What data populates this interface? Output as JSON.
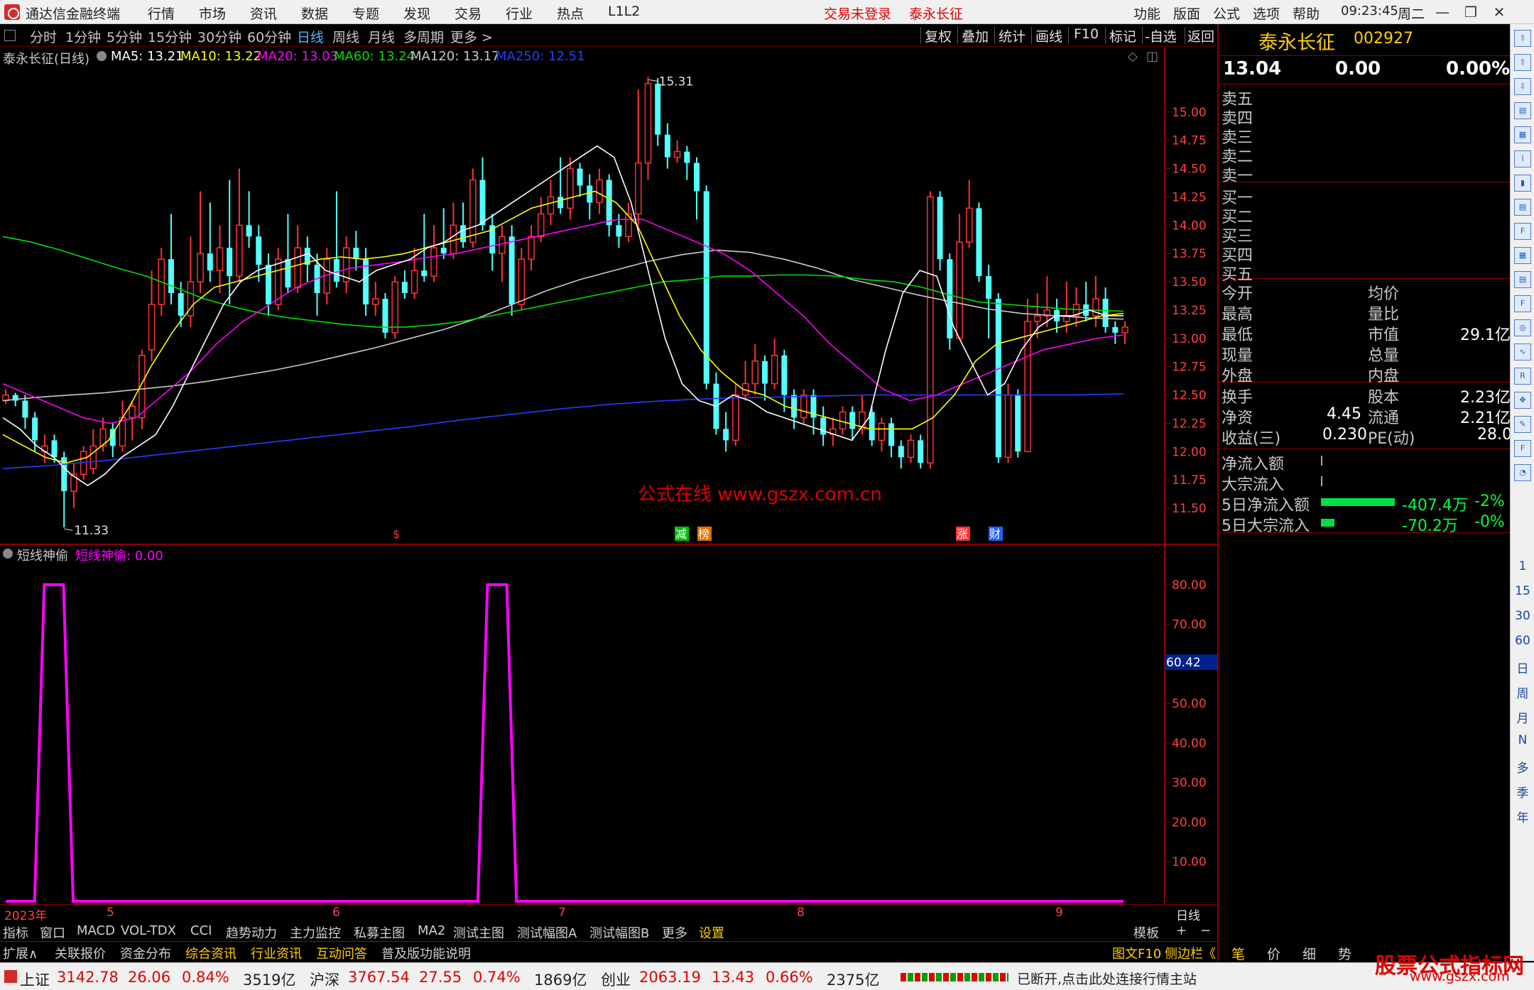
{
  "titlebar": {
    "app_name": "通达信金融终端",
    "menus": [
      "行情",
      "市场",
      "资讯",
      "数据",
      "专题",
      "发现",
      "交易",
      "行业",
      "热点",
      "L1L2"
    ],
    "login_status": "交易未登录",
    "stock_name": "泰永长征",
    "right_menus": [
      "功能",
      "版面",
      "公式",
      "选项",
      "帮助"
    ],
    "time": "09:23:45",
    "weekday": "周二"
  },
  "periodbar": {
    "periods": [
      "分时",
      "1分钟",
      "5分钟",
      "15分钟",
      "30分钟",
      "60分钟",
      "日线",
      "周线",
      "月线",
      "多周期",
      "更多 >"
    ],
    "active": "日线",
    "tools": [
      "复权",
      "叠加",
      "统计",
      "画线",
      "F10",
      "标记",
      "-自选",
      "返回"
    ]
  },
  "main_legend": {
    "title": "泰永长征(日线)",
    "items": [
      {
        "label": "MA5: 13.21",
        "color": "#ffffff"
      },
      {
        "label": "MA10: 13.22",
        "color": "#ffff00"
      },
      {
        "label": "MA20: 13.03",
        "color": "#ff00ff"
      },
      {
        "label": "MA60: 13.24",
        "color": "#00e000"
      },
      {
        "label": "MA120: 13.17",
        "color": "#c8c8c8"
      },
      {
        "label": "MA250: 12.51",
        "color": "#2040ff"
      }
    ]
  },
  "price_axis": [
    "15.00",
    "14.75",
    "14.50",
    "14.25",
    "14.00",
    "13.75",
    "13.50",
    "13.25",
    "13.00",
    "12.75",
    "12.50",
    "12.25",
    "12.00",
    "11.75",
    "11.50"
  ],
  "price_high_label": "15.31",
  "price_low_label": "11.33",
  "event_tags": [
    {
      "text": "$",
      "color": "#ff3030"
    },
    {
      "text": "减",
      "color": "#00c000"
    },
    {
      "text": "榜",
      "color": "#e07000"
    },
    {
      "text": "涨",
      "color": "#ff3030"
    },
    {
      "text": "财",
      "color": "#2060ff"
    }
  ],
  "watermark": "公式在线  www.gszx.com.cn",
  "sub_legend": {
    "title": "短线神偷",
    "item": "短线神偷: 0.00",
    "color": "#ff00ff"
  },
  "sub_axis": [
    "80.00",
    "70.00",
    "60.00",
    "50.00",
    "40.00",
    "30.00",
    "20.00",
    "10.00"
  ],
  "sub_cursor_value": "60.42",
  "x_axis": {
    "labels": [
      "2023年",
      "5",
      "6",
      "7",
      "8",
      "9"
    ],
    "period": "日线"
  },
  "tabbar1": {
    "items": [
      "指标",
      "窗口",
      "MACD",
      "VOL-TDX",
      "CCI",
      "趋势动力",
      "主力监控",
      "私募主图",
      "MA2",
      "测试主图",
      "测试幅图A",
      "测试幅图B",
      "更多",
      "设置"
    ],
    "right": [
      "模板",
      "+",
      "−"
    ]
  },
  "tabbar2": {
    "items": [
      "扩展∧",
      "关联报价",
      "资金分布",
      "综合资讯",
      "行业资讯",
      "互动问答",
      "普及版功能说明"
    ],
    "right": "图文F10",
    "side": "侧边栏《",
    "bottom_tabs": [
      "笔",
      "价",
      "细",
      "势"
    ]
  },
  "statusbar": {
    "sh": {
      "name": "上证",
      "price": "3142.78",
      "chg": "26.06",
      "pct": "0.84%",
      "amt": "3519亿"
    },
    "sz": {
      "name": "沪深",
      "price": "3767.54",
      "chg": "27.55",
      "pct": "0.74%",
      "amt": "1869亿"
    },
    "cy": {
      "name": "创业",
      "price": "2063.19",
      "chg": "13.43",
      "pct": "0.66%",
      "amt": "2375亿"
    },
    "msg": "已断开,点击此处连接行情主站"
  },
  "quote": {
    "name": "泰永长征",
    "code": "002927",
    "price": "13.04",
    "change": "0.00",
    "pct": "0.00%",
    "asks": [
      "卖五",
      "卖四",
      "卖三",
      "卖二",
      "卖一"
    ],
    "bids": [
      "买一",
      "买二",
      "买三",
      "买四",
      "买五"
    ],
    "stats": [
      {
        "l": "今开",
        "v": "",
        "l2": "均价",
        "v2": ""
      },
      {
        "l": "最高",
        "v": "",
        "l2": "量比",
        "v2": ""
      },
      {
        "l": "最低",
        "v": "",
        "l2": "市值",
        "v2": "29.1亿"
      },
      {
        "l": "现量",
        "v": "",
        "l2": "总量",
        "v2": ""
      },
      {
        "l": "外盘",
        "v": "",
        "l2": "内盘",
        "v2": ""
      }
    ],
    "stats2": [
      {
        "l": "换手",
        "v": "",
        "l2": "股本",
        "v2": "2.23亿"
      },
      {
        "l": "净资",
        "v": "4.45",
        "l2": "流通",
        "v2": "2.21亿"
      },
      {
        "l": "收益(三)",
        "v": "0.230",
        "l2": "PE(动)",
        "v2": "28.0"
      }
    ],
    "flows": [
      {
        "l": "净流入额",
        "v": "",
        "p": "",
        "bar": 0
      },
      {
        "l": "大宗流入",
        "v": "",
        "p": "",
        "bar": 0
      },
      {
        "l": "5日净流入额",
        "v": "-407.4万",
        "p": "-2%",
        "bar": 1.0
      },
      {
        "l": "5日大宗流入",
        "v": "-70.2万",
        "p": "-0%",
        "bar": 0.18
      }
    ]
  },
  "side_tools": [
    "1",
    "15",
    "30",
    "60",
    "日",
    "周",
    "月",
    "N",
    "多",
    "季",
    "年"
  ],
  "brand": {
    "name": "股票公式指标网",
    "url": "www.gszx.com"
  },
  "colors": {
    "up": "#ff3232",
    "down": "#54ffff",
    "bg": "#000000",
    "border": "#8a0000",
    "axis": "#ff4040"
  },
  "chart_data": {
    "type": "candlestick",
    "y_range": [
      11.3,
      15.4
    ],
    "high": 15.31,
    "low": 11.33,
    "candles": [
      [
        12.45,
        12.5,
        12.55,
        12.42
      ],
      [
        12.5,
        12.45,
        12.52,
        12.4
      ],
      [
        12.45,
        12.3,
        12.5,
        12.2
      ],
      [
        12.3,
        12.1,
        12.35,
        12.0
      ],
      [
        12.0,
        12.05,
        12.15,
        11.9
      ],
      [
        12.1,
        11.95,
        12.15,
        11.9
      ],
      [
        11.95,
        11.65,
        12.0,
        11.33
      ],
      [
        11.65,
        11.8,
        11.9,
        11.5
      ],
      [
        11.8,
        12.0,
        12.05,
        11.75
      ],
      [
        11.85,
        12.05,
        12.2,
        11.8
      ],
      [
        12.05,
        12.2,
        12.3,
        12.0
      ],
      [
        12.2,
        12.05,
        12.25,
        11.95
      ],
      [
        12.05,
        12.3,
        12.45,
        12.0
      ],
      [
        12.3,
        12.4,
        12.45,
        12.1
      ],
      [
        12.3,
        12.85,
        12.9,
        12.2
      ],
      [
        12.9,
        13.3,
        13.6,
        12.8
      ],
      [
        13.3,
        13.7,
        13.8,
        13.2
      ],
      [
        13.7,
        13.4,
        14.1,
        13.3
      ],
      [
        13.4,
        13.2,
        13.5,
        13.1
      ],
      [
        13.2,
        13.5,
        13.9,
        13.1
      ],
      [
        13.5,
        13.75,
        14.3,
        13.4
      ],
      [
        13.75,
        13.6,
        14.2,
        13.5
      ],
      [
        13.6,
        13.8,
        14.0,
        13.4
      ],
      [
        13.8,
        13.55,
        14.4,
        13.3
      ],
      [
        13.55,
        14.0,
        14.5,
        13.5
      ],
      [
        14.0,
        13.9,
        14.3,
        13.8
      ],
      [
        13.9,
        13.65,
        14.0,
        13.5
      ],
      [
        13.65,
        13.3,
        13.75,
        13.2
      ],
      [
        13.3,
        13.7,
        13.8,
        13.25
      ],
      [
        13.7,
        13.45,
        14.1,
        13.4
      ],
      [
        13.45,
        13.8,
        14.0,
        13.4
      ],
      [
        13.8,
        13.65,
        13.9,
        13.5
      ],
      [
        13.65,
        13.4,
        13.75,
        13.2
      ],
      [
        13.4,
        13.7,
        13.8,
        13.3
      ],
      [
        13.7,
        13.5,
        14.3,
        13.45
      ],
      [
        13.5,
        13.8,
        13.9,
        13.4
      ],
      [
        13.8,
        13.7,
        13.95,
        13.6
      ],
      [
        13.7,
        13.3,
        13.8,
        13.2
      ],
      [
        13.3,
        13.35,
        13.5,
        13.2
      ],
      [
        13.35,
        13.05,
        13.4,
        13.0
      ],
      [
        13.05,
        13.5,
        13.55,
        13.0
      ],
      [
        13.5,
        13.4,
        13.6,
        13.35
      ],
      [
        13.4,
        13.6,
        13.8,
        13.35
      ],
      [
        13.6,
        13.55,
        14.1,
        13.5
      ],
      [
        13.55,
        13.8,
        14.0,
        13.5
      ],
      [
        13.8,
        13.75,
        14.15,
        13.7
      ],
      [
        13.75,
        14.0,
        14.2,
        13.7
      ],
      [
        14.0,
        13.85,
        14.2,
        13.8
      ],
      [
        13.85,
        14.4,
        14.5,
        13.8
      ],
      [
        14.4,
        14.0,
        14.6,
        13.95
      ],
      [
        14.0,
        13.75,
        14.1,
        13.6
      ],
      [
        13.75,
        13.9,
        14.0,
        13.5
      ],
      [
        13.9,
        13.3,
        14.0,
        13.2
      ],
      [
        13.3,
        13.7,
        13.8,
        13.25
      ],
      [
        13.7,
        13.9,
        14.0,
        13.6
      ],
      [
        13.9,
        14.1,
        14.25,
        13.85
      ],
      [
        14.1,
        14.25,
        14.4,
        14.0
      ],
      [
        14.25,
        14.15,
        14.6,
        14.1
      ],
      [
        14.15,
        14.5,
        14.6,
        14.05
      ],
      [
        14.5,
        14.35,
        14.55,
        14.25
      ],
      [
        14.35,
        14.2,
        14.45,
        14.05
      ],
      [
        14.2,
        14.4,
        14.5,
        14.1
      ],
      [
        14.4,
        14.0,
        14.45,
        13.9
      ],
      [
        14.0,
        13.9,
        14.1,
        13.8
      ],
      [
        13.9,
        14.1,
        14.2,
        13.85
      ],
      [
        14.1,
        14.55,
        15.2,
        14.0
      ],
      [
        14.55,
        15.25,
        15.31,
        14.4
      ],
      [
        15.25,
        14.8,
        15.3,
        14.7
      ],
      [
        14.8,
        14.6,
        14.9,
        14.5
      ],
      [
        14.6,
        14.65,
        14.75,
        14.55
      ],
      [
        14.65,
        14.55,
        14.7,
        14.4
      ],
      [
        14.55,
        14.3,
        14.6,
        14.05
      ],
      [
        14.3,
        12.6,
        14.35,
        12.55
      ],
      [
        12.6,
        12.2,
        12.7,
        12.15
      ],
      [
        12.2,
        12.1,
        12.35,
        12.0
      ],
      [
        12.1,
        12.5,
        12.6,
        12.05
      ],
      [
        12.5,
        12.6,
        12.8,
        12.45
      ],
      [
        12.6,
        12.8,
        12.95,
        12.5
      ],
      [
        12.8,
        12.6,
        12.85,
        12.45
      ],
      [
        12.6,
        12.85,
        13.0,
        12.55
      ],
      [
        12.85,
        12.5,
        12.9,
        12.35
      ],
      [
        12.5,
        12.3,
        12.55,
        12.2
      ],
      [
        12.3,
        12.5,
        12.55,
        12.25
      ],
      [
        12.5,
        12.3,
        12.55,
        12.15
      ],
      [
        12.3,
        12.15,
        12.4,
        12.05
      ],
      [
        12.15,
        12.2,
        12.3,
        12.05
      ],
      [
        12.2,
        12.35,
        12.4,
        12.15
      ],
      [
        12.35,
        12.2,
        12.4,
        12.1
      ],
      [
        12.2,
        12.35,
        12.5,
        12.15
      ],
      [
        12.35,
        12.1,
        12.4,
        12.05
      ],
      [
        12.1,
        12.25,
        12.3,
        12.0
      ],
      [
        12.25,
        12.05,
        12.3,
        11.95
      ],
      [
        12.05,
        11.95,
        12.1,
        11.85
      ],
      [
        11.95,
        12.1,
        12.15,
        11.9
      ],
      [
        12.1,
        11.9,
        12.15,
        11.85
      ],
      [
        11.9,
        14.25,
        14.3,
        11.85
      ],
      [
        14.25,
        13.7,
        14.3,
        13.6
      ],
      [
        13.7,
        13.0,
        13.75,
        12.9
      ],
      [
        13.0,
        13.85,
        14.1,
        13.0
      ],
      [
        13.85,
        14.15,
        14.4,
        13.8
      ],
      [
        14.15,
        13.55,
        14.2,
        13.5
      ],
      [
        13.55,
        13.35,
        13.65,
        13.0
      ],
      [
        13.35,
        11.95,
        13.4,
        11.9
      ],
      [
        11.95,
        12.5,
        12.6,
        11.9
      ],
      [
        12.5,
        12.0,
        12.55,
        11.95
      ],
      [
        12.0,
        13.15,
        13.35,
        12.0
      ],
      [
        13.15,
        13.2,
        13.4,
        13.0
      ],
      [
        13.2,
        13.25,
        13.55,
        13.1
      ],
      [
        13.25,
        13.15,
        13.35,
        13.05
      ],
      [
        13.15,
        13.2,
        13.5,
        13.05
      ],
      [
        13.2,
        13.3,
        13.45,
        13.1
      ],
      [
        13.3,
        13.2,
        13.5,
        13.15
      ],
      [
        13.2,
        13.35,
        13.55,
        13.1
      ],
      [
        13.35,
        13.1,
        13.45,
        13.05
      ],
      [
        13.1,
        13.05,
        13.15,
        12.95
      ],
      [
        13.05,
        13.1,
        13.15,
        12.95
      ]
    ],
    "ma5": [
      12.3,
      12.2,
      12.05,
      11.95,
      11.8,
      11.7,
      11.8,
      11.95,
      12.05,
      12.15,
      12.4,
      12.7,
      13.0,
      13.3,
      13.5,
      13.6,
      13.65,
      13.7,
      13.75,
      13.6,
      13.55,
      13.5,
      13.6,
      13.65,
      13.7,
      13.8,
      13.85,
      13.95,
      14.0,
      14.1,
      14.2,
      14.3,
      14.4,
      14.5,
      14.6,
      14.7,
      14.6,
      14.2,
      13.6,
      13.0,
      12.6,
      12.45,
      12.4,
      12.5,
      12.45,
      12.35,
      12.3,
      12.25,
      12.2,
      12.15,
      12.1,
      12.3,
      12.9,
      13.4,
      13.6,
      13.55,
      13.1,
      12.8,
      12.5,
      12.6,
      12.9,
      13.1,
      13.2,
      13.2,
      13.25,
      13.2,
      13.2
    ],
    "ma10": [
      12.15,
      12.05,
      11.95,
      11.9,
      11.95,
      12.1,
      12.4,
      12.75,
      13.05,
      13.3,
      13.45,
      13.5,
      13.55,
      13.6,
      13.65,
      13.7,
      13.72,
      13.7,
      13.72,
      13.75,
      13.8,
      13.85,
      13.9,
      13.95,
      14.05,
      14.15,
      14.2,
      14.25,
      14.3,
      14.2,
      14.0,
      13.6,
      13.2,
      12.9,
      12.7,
      12.55,
      12.5,
      12.4,
      12.35,
      12.3,
      12.25,
      12.2,
      12.2,
      12.2,
      12.3,
      12.5,
      12.8,
      12.95,
      13.0,
      13.05,
      13.1,
      13.15,
      13.2,
      13.22
    ],
    "ma20": [
      12.6,
      12.5,
      12.4,
      12.3,
      12.25,
      12.3,
      12.5,
      12.7,
      12.95,
      13.15,
      13.3,
      13.45,
      13.55,
      13.62,
      13.65,
      13.68,
      13.72,
      13.75,
      13.8,
      13.85,
      13.9,
      13.95,
      14.0,
      14.05,
      14.05,
      13.95,
      13.85,
      13.75,
      13.6,
      13.4,
      13.2,
      12.95,
      12.75,
      12.55,
      12.45,
      12.5,
      12.6,
      12.7,
      12.8,
      12.9,
      12.95,
      13.0,
      13.03
    ],
    "ma60": [
      13.9,
      13.85,
      13.78,
      13.7,
      13.62,
      13.55,
      13.45,
      13.35,
      13.28,
      13.22,
      13.18,
      13.15,
      13.12,
      13.1,
      13.1,
      13.12,
      13.15,
      13.2,
      13.25,
      13.3,
      13.35,
      13.4,
      13.45,
      13.5,
      13.52,
      13.55,
      13.55,
      13.56,
      13.56,
      13.55,
      13.52,
      13.5,
      13.45,
      13.38,
      13.32,
      13.3,
      13.28,
      13.26,
      13.25,
      13.24
    ],
    "ma120": [
      12.45,
      12.48,
      12.5,
      12.52,
      12.55,
      12.58,
      12.62,
      12.67,
      12.72,
      12.78,
      12.85,
      12.92,
      13.0,
      13.08,
      13.18,
      13.3,
      13.42,
      13.52,
      13.6,
      13.68,
      13.74,
      13.78,
      13.76,
      13.7,
      13.62,
      13.52,
      13.45,
      13.38,
      13.32,
      13.26,
      13.22,
      13.2,
      13.18,
      13.17
    ],
    "ma250": [
      11.85,
      11.88,
      11.92,
      11.97,
      12.02,
      12.07,
      12.12,
      12.17,
      12.22,
      12.28,
      12.33,
      12.38,
      12.42,
      12.45,
      12.47,
      12.48,
      12.49,
      12.5,
      12.5,
      12.5,
      12.5,
      12.5,
      12.51
    ],
    "sub": {
      "type": "line",
      "name": "短线神偷",
      "y_range": [
        0,
        85
      ],
      "pulses": [
        {
          "from": 4,
          "to": 6,
          "value": 80
        },
        {
          "from": 50,
          "to": 52,
          "value": 80
        }
      ],
      "count": 117
    }
  }
}
